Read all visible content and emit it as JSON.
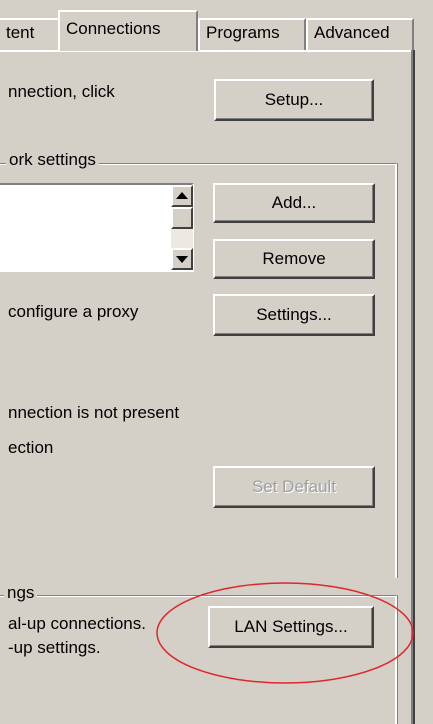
{
  "tabs": [
    {
      "label": "tent"
    },
    {
      "label": "Connections"
    },
    {
      "label": "Programs"
    },
    {
      "label": "Advanced"
    }
  ],
  "setup_text": "nnection, click",
  "setup_button": "Setup...",
  "network_group_label": "ork settings",
  "add_button": "Add...",
  "remove_button": "Remove",
  "proxy_text": "configure a proxy",
  "settings_button": "Settings...",
  "line1": "nnection is not present",
  "line2": "ection",
  "set_default_button": "Set Default",
  "lan_group_label": "ngs",
  "lan_text1": "al-up connections.",
  "lan_text2": "-up settings.",
  "lan_button": "LAN Settings...",
  "highlight_color": "#e0262b"
}
